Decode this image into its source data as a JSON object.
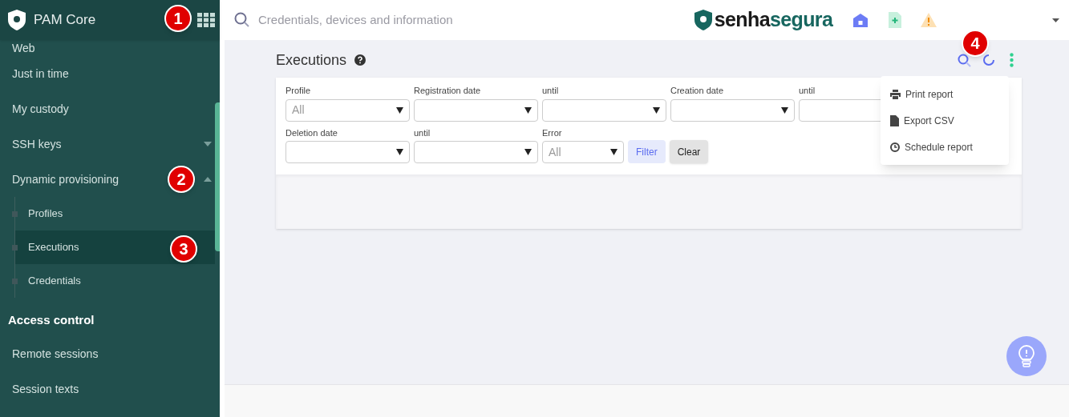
{
  "sidebar": {
    "title": "PAM Core",
    "items": [
      {
        "label": "Web",
        "kind": "item",
        "selected": false
      },
      {
        "label": "Just in time",
        "kind": "item",
        "selected": false
      },
      {
        "label": "My custody",
        "kind": "item",
        "selected": false
      },
      {
        "label": "SSH keys",
        "kind": "group",
        "expanded": false,
        "selected": false
      },
      {
        "label": "Dynamic provisioning",
        "kind": "group",
        "expanded": true,
        "selected": false,
        "children": [
          {
            "label": "Profiles",
            "selected": false
          },
          {
            "label": "Executions",
            "selected": true
          },
          {
            "label": "Credentials",
            "selected": false
          }
        ]
      },
      {
        "label": "Access control",
        "kind": "heading"
      },
      {
        "label": "Remote sessions",
        "kind": "item",
        "selected": false
      },
      {
        "label": "Session texts",
        "kind": "item",
        "selected": false
      }
    ]
  },
  "topbar": {
    "search": {
      "placeholder": "Credentials, devices and information"
    },
    "brand": {
      "part1": "senha",
      "part2": "segura"
    }
  },
  "page": {
    "title": "Executions",
    "filters": [
      [
        {
          "label": "Profile",
          "value": "All",
          "kind": "wide"
        },
        {
          "label": "Registration date",
          "kind": "wide"
        },
        {
          "label": "until",
          "kind": "wide"
        },
        {
          "label": "Creation date",
          "kind": "wide"
        },
        {
          "label": "until",
          "kind": "covered"
        }
      ],
      [
        {
          "label": "Deletion date",
          "kind": "wide"
        },
        {
          "label": "until",
          "kind": "wide"
        },
        {
          "label": "Error",
          "value": "All",
          "kind": "compact"
        }
      ]
    ],
    "buttons": [
      {
        "label": "Filter",
        "kind": "primary"
      },
      {
        "label": "Clear",
        "kind": "secondary"
      }
    ],
    "menu": [
      {
        "label": "Print report",
        "kind": "print"
      },
      {
        "label": "Export CSV",
        "kind": "file"
      },
      {
        "label": "Schedule report",
        "kind": "clock"
      }
    ]
  },
  "callouts": [
    {
      "text": "1"
    },
    {
      "text": "2"
    },
    {
      "text": "3"
    },
    {
      "text": "4"
    }
  ]
}
